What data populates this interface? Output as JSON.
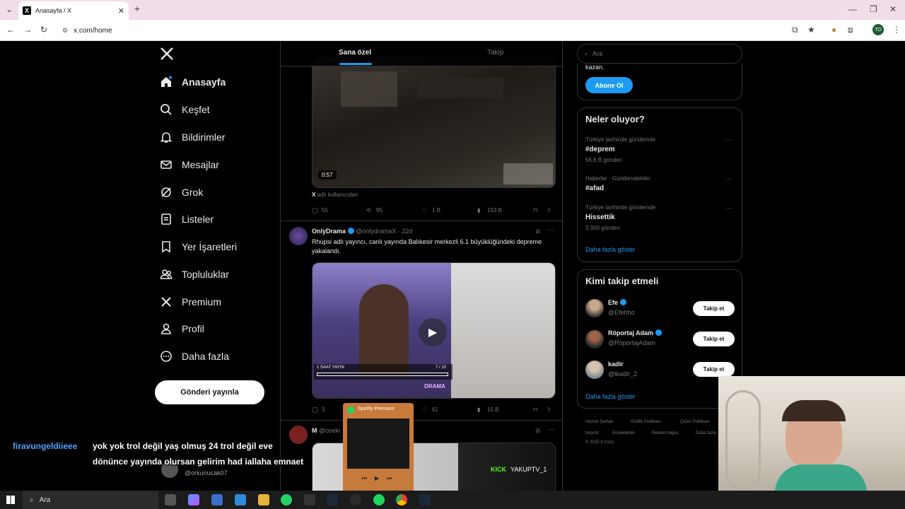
{
  "browser": {
    "tab_title": "Anasayfa / X",
    "url": "x.com/home",
    "profile_initials": "TO",
    "tab_favicon": "X"
  },
  "nav": {
    "logo": "X",
    "items": [
      {
        "label": "Anasayfa",
        "icon": "home-icon"
      },
      {
        "label": "Keşfet",
        "icon": "search-icon"
      },
      {
        "label": "Bildirimler",
        "icon": "bell-icon"
      },
      {
        "label": "Mesajlar",
        "icon": "mail-icon"
      },
      {
        "label": "Grok",
        "icon": "grok-icon"
      },
      {
        "label": "Listeler",
        "icon": "list-icon"
      },
      {
        "label": "Yer İşaretleri",
        "icon": "bookmark-icon"
      },
      {
        "label": "Topluluklar",
        "icon": "people-icon"
      },
      {
        "label": "Premium",
        "icon": "x-icon"
      },
      {
        "label": "Profil",
        "icon": "user-icon"
      },
      {
        "label": "Daha fazla",
        "icon": "more-icon"
      }
    ],
    "post_button": "Gönderi yayınla"
  },
  "feed": {
    "tabs": [
      "Sana özel",
      "Takip"
    ],
    "post1": {
      "duration": "0:57",
      "source_prefix": "X",
      "source_text": "adlı kullanıcıdan",
      "replies": "55",
      "reposts": "95",
      "likes": "1 B",
      "views": "153 B"
    },
    "post2": {
      "name": "OnlyDrama",
      "handle": "@onlydramaX",
      "time": "· 22d",
      "text": "Rhupsi adlı yayıncı, canlı yayında Balıkesir merkezli 6.1 büyüklüğündeki depreme yakalandı.",
      "replies": "3",
      "likes": "61",
      "views": "15 B",
      "overlay_text": "1 SAAT YAYIN",
      "overlay_count": "7 / 10",
      "overlay_brand": "DRAMA"
    },
    "post3": {
      "name": "M",
      "handle": "@oseki",
      "overlay": "YAKUPTV_1",
      "overlay_brand": "KICK"
    }
  },
  "right": {
    "search_placeholder": "Ara",
    "premium_text": "kazan.",
    "subscribe_button": "Abone Ol",
    "trends_title": "Neler oluyor?",
    "trends": [
      {
        "context": "Türkiye tarihinde gündemde",
        "name": "#deprem",
        "count": "56,6 B gönderi"
      },
      {
        "context": "Haberler · Gündemdekiler",
        "name": "#afad",
        "count": ""
      },
      {
        "context": "Türkiye tarihinde gündemde",
        "name": "Hissettik",
        "count": "3.300 gönderi"
      }
    ],
    "show_more": "Daha fazla göster",
    "who_title": "Kimi takip etmeli",
    "who": [
      {
        "name": "Efe",
        "handle": "@Efehho"
      },
      {
        "name": "Röportaj Adam",
        "handle": "@RoportajAdam"
      },
      {
        "name": "kadir",
        "handle": "@tkadlr_2"
      }
    ],
    "follow_label": "Takip et",
    "footer": [
      "Hizmet Şartları",
      "Gizlilik Politikası",
      "Çerez Politikası",
      "Imprint",
      "Erişilebilirlik",
      "Reklam bilgisi",
      "Daha fazla"
    ],
    "copyright": "© 2025 X Corp."
  },
  "spotify": {
    "title": "Spotify Premium"
  },
  "chat": {
    "user": "firavungeldiieee",
    "message": "yok yok trol değil yaş olmuş 24 trol değil eve dönünce yayında olursan gelirim had iallaha emnaet",
    "handle_behind": "@orkunucak07"
  },
  "taskbar": {
    "search": "Ara"
  },
  "colors": {
    "accent": "#1d9bf0",
    "bg": "#000000",
    "border": "#2f3336",
    "chat_user": "#4aa3ff"
  }
}
